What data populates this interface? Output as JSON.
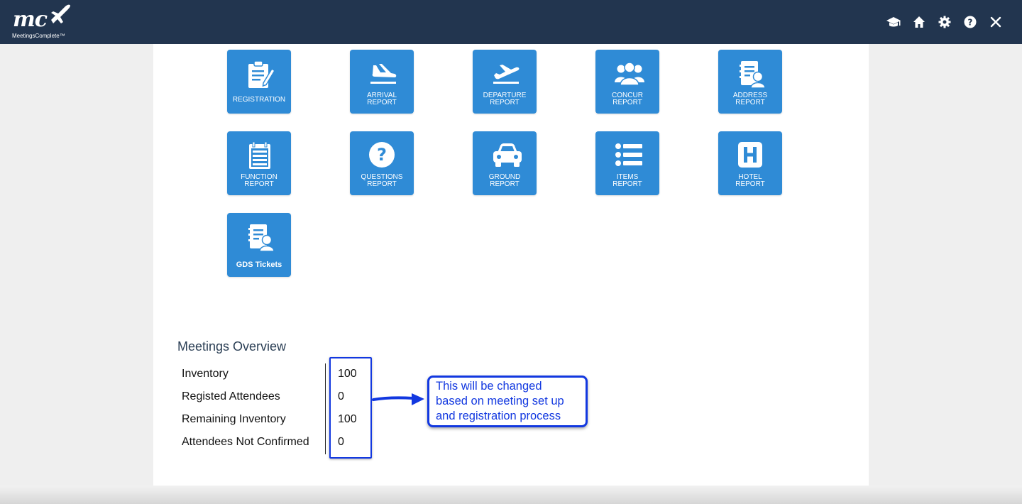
{
  "header": {
    "logo_mark": "mc",
    "logo_text": "MeetingsComplete™",
    "icons": [
      "graduation-cap-icon",
      "home-icon",
      "gear-icon",
      "help-icon",
      "close-icon"
    ]
  },
  "tiles": [
    {
      "icon": "clipboard-icon",
      "label": "REGISTRATION"
    },
    {
      "icon": "plane-landing-icon",
      "label_line1": "ARRIVAL",
      "label_line2": "REPORT"
    },
    {
      "icon": "plane-takeoff-icon",
      "label_line1": "DEPARTURE",
      "label_line2": "REPORT"
    },
    {
      "icon": "group-icon",
      "label_line1": "CONCUR",
      "label_line2": "REPORT"
    },
    {
      "icon": "address-book-icon",
      "label_line1": "ADDRESS",
      "label_line2": "REPORT"
    },
    {
      "icon": "calendar-list-icon",
      "label_line1": "FUNCTION",
      "label_line2": "REPORT"
    },
    {
      "icon": "question-icon",
      "label_line1": "QUESTIONS",
      "label_line2": "REPORT"
    },
    {
      "icon": "car-icon",
      "label_line1": "GROUND",
      "label_line2": "REPORT"
    },
    {
      "icon": "list-icon",
      "label_line1": "ITEMS",
      "label_line2": "REPORT"
    },
    {
      "icon": "hotel-icon",
      "label_line1": "HOTEL",
      "label_line2": "REPORT"
    },
    {
      "icon": "ticket-person-icon",
      "label": "GDS Tickets"
    }
  ],
  "overview": {
    "title": "Meetings Overview",
    "rows": [
      {
        "label": "Inventory",
        "value": "100"
      },
      {
        "label": "Registed Attendees",
        "value": "0"
      },
      {
        "label": "Remaining Inventory",
        "value": "100"
      },
      {
        "label": "Attendees Not Confirmed",
        "value": "0"
      }
    ]
  },
  "annotation": {
    "line1": "This will be changed",
    "line2": "based on meeting set up",
    "line3": "and registration process"
  },
  "colors": {
    "header_bg": "#22354f",
    "tile_bg": "#2f8bd6",
    "annotation": "#1238e0"
  }
}
